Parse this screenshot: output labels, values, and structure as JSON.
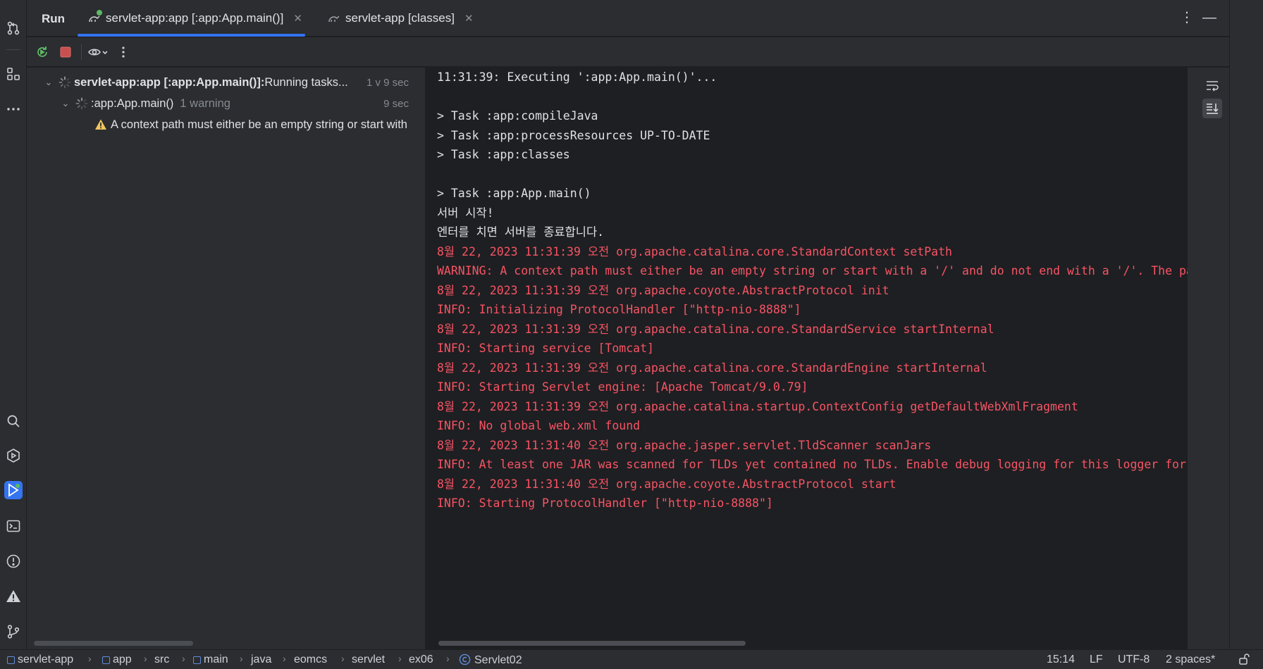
{
  "tool_window": {
    "title": "Run",
    "tabs": [
      {
        "label": "servlet-app:app [:app:App.main()]",
        "active": true
      },
      {
        "label": "servlet-app [classes]",
        "active": false
      }
    ]
  },
  "tree": {
    "root": {
      "label_bold": "servlet-app:app [:app:App.main()]:",
      "label_rest": " Running tasks...",
      "time": "1 v 9 sec"
    },
    "child": {
      "label": ":app:App.main()",
      "note": "1 warning",
      "time": "9 sec"
    },
    "warning": {
      "label": "A context path must either be an empty string or start with"
    }
  },
  "console": {
    "lines": [
      {
        "text": "11:31:39: Executing ':app:App.main()'...",
        "err": false
      },
      {
        "text": "",
        "err": false
      },
      {
        "text": "> Task :app:compileJava",
        "err": false
      },
      {
        "text": "> Task :app:processResources UP-TO-DATE",
        "err": false
      },
      {
        "text": "> Task :app:classes",
        "err": false
      },
      {
        "text": "",
        "err": false
      },
      {
        "text": "> Task :app:App.main()",
        "err": false
      },
      {
        "text": "서버 시작!",
        "err": false
      },
      {
        "text": "엔터를 치면 서버를 종료합니다.",
        "err": false
      },
      {
        "text": "8월 22, 2023 11:31:39 오전 org.apache.catalina.core.StandardContext setPath",
        "err": true
      },
      {
        "text": "WARNING: A context path must either be an empty string or start with a '/' and do not end with a '/'. The path [/]",
        "err": true
      },
      {
        "text": "8월 22, 2023 11:31:39 오전 org.apache.coyote.AbstractProtocol init",
        "err": true
      },
      {
        "text": "INFO: Initializing ProtocolHandler [\"http-nio-8888\"]",
        "err": true
      },
      {
        "text": "8월 22, 2023 11:31:39 오전 org.apache.catalina.core.StandardService startInternal",
        "err": true
      },
      {
        "text": "INFO: Starting service [Tomcat]",
        "err": true
      },
      {
        "text": "8월 22, 2023 11:31:39 오전 org.apache.catalina.core.StandardEngine startInternal",
        "err": true
      },
      {
        "text": "INFO: Starting Servlet engine: [Apache Tomcat/9.0.79]",
        "err": true
      },
      {
        "text": "8월 22, 2023 11:31:39 오전 org.apache.catalina.startup.ContextConfig getDefaultWebXmlFragment",
        "err": true
      },
      {
        "text": "INFO: No global web.xml found",
        "err": true
      },
      {
        "text": "8월 22, 2023 11:31:40 오전 org.apache.jasper.servlet.TldScanner scanJars",
        "err": true
      },
      {
        "text": "INFO: At least one JAR was scanned for TLDs yet contained no TLDs. Enable debug logging for this logger for a comp",
        "err": true
      },
      {
        "text": "8월 22, 2023 11:31:40 오전 org.apache.coyote.AbstractProtocol start",
        "err": true
      },
      {
        "text": "INFO: Starting ProtocolHandler [\"http-nio-8888\"]",
        "err": true
      }
    ]
  },
  "statusbar": {
    "breadcrumbs": [
      "servlet-app",
      "app",
      "src",
      "main",
      "java",
      "eomcs",
      "servlet",
      "ex06",
      "Servlet02"
    ],
    "position": "15:14",
    "line_separator": "LF",
    "encoding": "UTF-8",
    "indent": "2 spaces*"
  },
  "colors": {
    "accent": "#3574f0",
    "error_text": "#f75464",
    "warning": "#f2c55c",
    "running_badge": "#5fb865"
  }
}
